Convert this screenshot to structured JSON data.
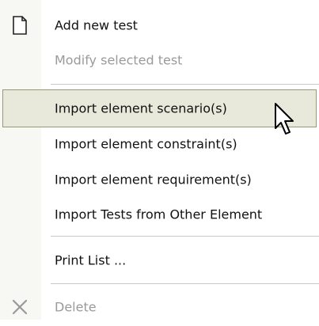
{
  "menu": {
    "items": [
      {
        "label": "Add new test",
        "icon": "new-document-icon",
        "state": "enabled"
      },
      {
        "label": "Modify selected test",
        "state": "disabled"
      },
      {
        "label": "Import element scenario(s)",
        "state": "highlighted"
      },
      {
        "label": "Import element constraint(s)",
        "state": "enabled"
      },
      {
        "label": "Import element requirement(s)",
        "state": "enabled"
      },
      {
        "label": "Import Tests from Other Element",
        "state": "enabled"
      },
      {
        "label": "Print List ...",
        "state": "enabled"
      },
      {
        "label": "Delete",
        "icon": "delete-x-icon",
        "state": "disabled"
      }
    ]
  },
  "colors": {
    "highlight_bg": "#e8e9da",
    "highlight_border": "#949a73",
    "gutter_bg": "#f7f7f4",
    "disabled_text": "#9a9a9a"
  }
}
